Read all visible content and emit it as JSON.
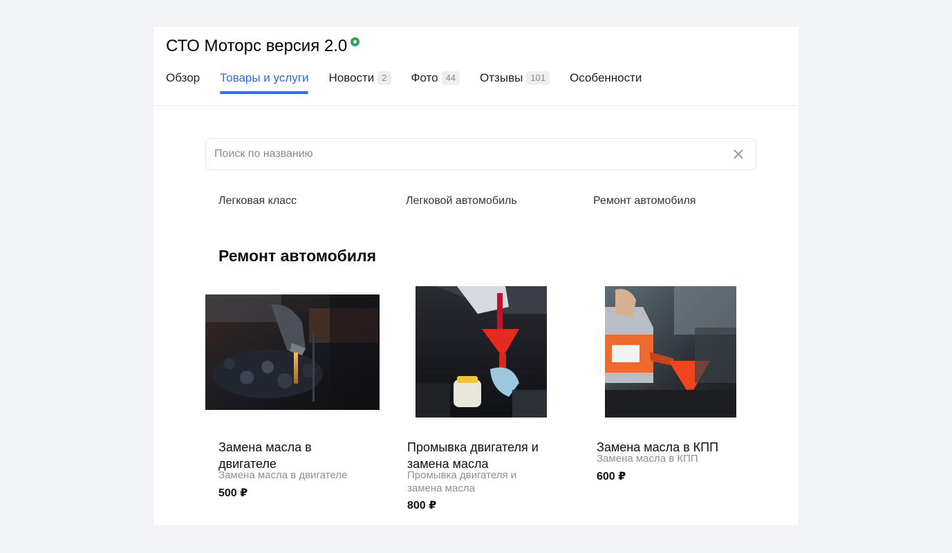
{
  "business": {
    "name": "СТО Моторс версия 2.0",
    "verified_icon": "verified-check-icon"
  },
  "tabs": [
    {
      "label": "Обзор",
      "count": null,
      "active": false
    },
    {
      "label": "Товары и услуги",
      "count": null,
      "active": true
    },
    {
      "label": "Новости",
      "count": "2",
      "active": false
    },
    {
      "label": "Фото",
      "count": "44",
      "active": false
    },
    {
      "label": "Отзывы",
      "count": "101",
      "active": false
    },
    {
      "label": "Особенности",
      "count": null,
      "active": false
    }
  ],
  "search": {
    "placeholder": "Поиск по названию",
    "value": "",
    "clear_icon": "close-icon"
  },
  "categories": [
    "Легковая класс",
    "Легковой автомобиль",
    "Ремонт автомобиля"
  ],
  "section": {
    "title": "Ремонт автомобиля"
  },
  "products": [
    {
      "name": "Замена масла в двигателе",
      "description": "Замена масла в двигателе",
      "price": "500 ₽",
      "image": "oil-pouring-into-engine-photo"
    },
    {
      "name": "Промывка двигателя и замена масла",
      "description": "Промывка двигателя и замена масла",
      "price": "800 ₽",
      "image": "red-funnel-engine-photo"
    },
    {
      "name": "Замена масла в КПП",
      "description": "Замена масла в КПП",
      "price": "600 ₽",
      "image": "oil-jug-funnel-photo"
    }
  ],
  "colors": {
    "background": "#f2f3f7",
    "accent": "#2a72ee",
    "verified": "#2da65a",
    "muted_text": "#8f8f94"
  }
}
